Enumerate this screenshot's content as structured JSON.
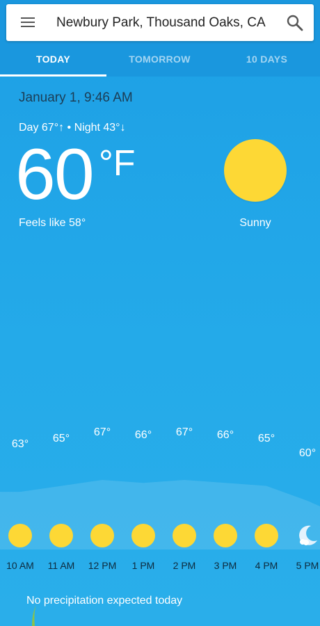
{
  "search": {
    "location": "Newbury Park, Thousand Oaks, CA",
    "menu_icon": "menu-icon",
    "search_icon": "search-icon"
  },
  "tabs": [
    {
      "label": "TODAY",
      "active": true
    },
    {
      "label": "TOMORROW",
      "active": false
    },
    {
      "label": "10 DAYS",
      "active": false
    }
  ],
  "current": {
    "datetime": "January 1, 9:46 AM",
    "day_night": "Day 67°↑ • Night 43°↓",
    "temperature": "60",
    "unit": "°F",
    "feels_like": "Feels like 58°",
    "condition": "Sunny",
    "icon": "sun-icon"
  },
  "hourly": [
    {
      "time": "10 AM",
      "temp": "63°",
      "value": 63,
      "icon": "sun-icon"
    },
    {
      "time": "11 AM",
      "temp": "65°",
      "value": 65,
      "icon": "sun-icon"
    },
    {
      "time": "12 PM",
      "temp": "67°",
      "value": 67,
      "icon": "sun-icon"
    },
    {
      "time": "1 PM",
      "temp": "66°",
      "value": 66,
      "icon": "sun-icon"
    },
    {
      "time": "2 PM",
      "temp": "67°",
      "value": 67,
      "icon": "sun-icon"
    },
    {
      "time": "3 PM",
      "temp": "66°",
      "value": 66,
      "icon": "sun-icon"
    },
    {
      "time": "4 PM",
      "temp": "65°",
      "value": 65,
      "icon": "sun-icon"
    },
    {
      "time": "5 PM",
      "temp": "60°",
      "value": 60,
      "icon": "moon-icon"
    }
  ],
  "precipitation": "No precipitation expected today",
  "colors": {
    "sky": "#1d9fe5",
    "sun": "#fdd835",
    "header": "#1a97de"
  }
}
